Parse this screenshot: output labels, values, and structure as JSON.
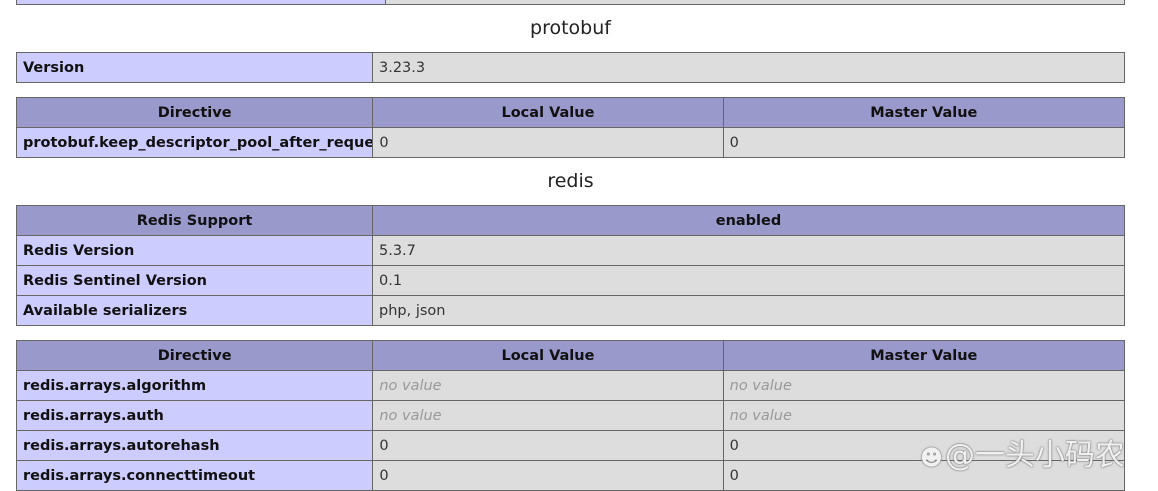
{
  "protobuf": {
    "title": "protobuf",
    "version_label": "Version",
    "version_value": "3.23.3",
    "directive_headers": [
      "Directive",
      "Local Value",
      "Master Value"
    ],
    "directives": [
      {
        "name": "protobuf.keep_descriptor_pool_after_request",
        "local": "0",
        "master": "0"
      }
    ]
  },
  "redis": {
    "title": "redis",
    "support_label": "Redis Support",
    "support_value": "enabled",
    "info": [
      {
        "label": "Redis Version",
        "value": "5.3.7"
      },
      {
        "label": "Redis Sentinel Version",
        "value": "0.1"
      },
      {
        "label": "Available serializers",
        "value": "php, json"
      }
    ],
    "directive_headers": [
      "Directive",
      "Local Value",
      "Master Value"
    ],
    "directives": [
      {
        "name": "redis.arrays.algorithm",
        "local": "no value",
        "master": "no value"
      },
      {
        "name": "redis.arrays.auth",
        "local": "no value",
        "master": "no value"
      },
      {
        "name": "redis.arrays.autorehash",
        "local": "0",
        "master": "0"
      },
      {
        "name": "redis.arrays.connecttimeout",
        "local": "0",
        "master": "0"
      }
    ]
  },
  "watermark": {
    "text": "@一头小码农",
    "icon": "weibo-icon"
  }
}
